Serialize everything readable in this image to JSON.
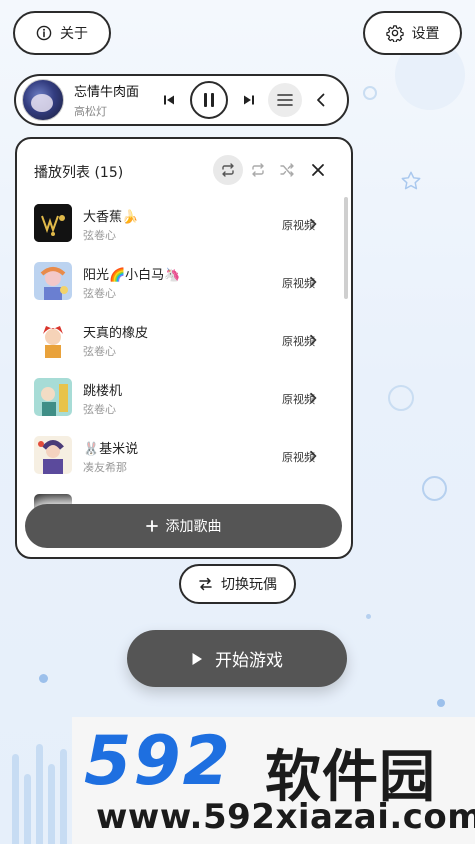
{
  "header": {
    "about_label": "关于",
    "settings_label": "设置"
  },
  "player": {
    "title": "忘情牛肉面",
    "artist": "高松灯"
  },
  "playlist": {
    "title": "播放列表 (15)",
    "songs": [
      {
        "title": "大香蕉🍌",
        "artist": "弦卷心",
        "action": "原视频"
      },
      {
        "title": "阳光🌈小白马🦄",
        "artist": "弦卷心",
        "action": "原视频"
      },
      {
        "title": "天真的橡皮",
        "artist": "弦卷心",
        "action": "原视频"
      },
      {
        "title": "跳楼机",
        "artist": "弦卷心",
        "action": "原视频"
      },
      {
        "title": "🐰基米说",
        "artist": "凑友希那",
        "action": "原视频"
      }
    ],
    "add_label": "添加歌曲"
  },
  "switch_label": "切换玩偶",
  "start_label": "开始游戏",
  "watermark": {
    "brand_number": "592",
    "brand_text": "软件园",
    "url": "www.592xiazai.com"
  },
  "colors": {
    "dark_button": "#555555",
    "outline": "#2b2b2b",
    "watermark_blue": "#1e6fe0"
  },
  "icons": {
    "about": "info-icon",
    "settings": "gear-icon",
    "prev": "skip-previous-icon",
    "pause": "pause-icon",
    "next": "skip-next-icon",
    "list": "menu-icon",
    "collapse": "chevron-left-icon",
    "repeat_all": "repeat-icon",
    "repeat_one": "repeat-one-icon",
    "shuffle": "shuffle-icon",
    "close": "close-icon",
    "add": "plus-icon",
    "switch": "swap-icon",
    "start": "play-icon"
  }
}
